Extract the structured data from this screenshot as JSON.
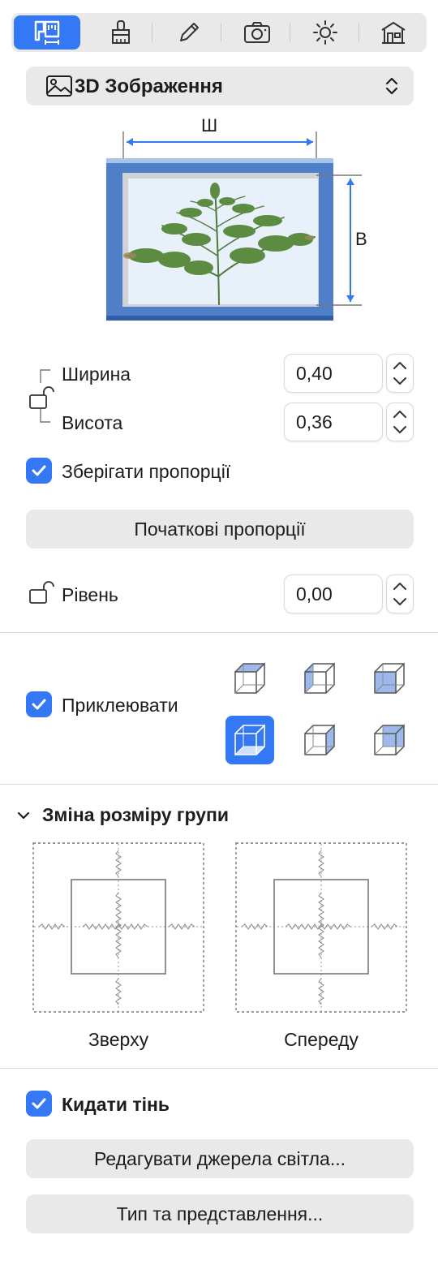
{
  "toolbar": {
    "tabs": [
      {
        "icon": "dimensions-icon",
        "active": true
      },
      {
        "icon": "brush-icon",
        "active": false
      },
      {
        "icon": "pencil-icon",
        "active": false
      },
      {
        "icon": "camera-icon",
        "active": false
      },
      {
        "icon": "sun-icon",
        "active": false
      },
      {
        "icon": "house-icon",
        "active": false
      }
    ]
  },
  "object_type": {
    "label": "3D Зображення",
    "icon": "image-icon"
  },
  "preview": {
    "width_marker": "Ш",
    "height_marker": "В"
  },
  "size": {
    "width_label": "Ширина",
    "width_value": "0,40",
    "height_label": "Висота",
    "height_value": "0,36"
  },
  "keep_proportions": {
    "label": "Зберігати пропорції",
    "checked": true
  },
  "reset_proportions_button": "Початкові пропорції",
  "level": {
    "label": "Рівень",
    "value": "0,00"
  },
  "glue": {
    "label": "Приклеювати",
    "checked": true,
    "selected_option": 4
  },
  "group_resize": {
    "title": "Зміна розміру групи",
    "top_label": "Зверху",
    "front_label": "Спереду"
  },
  "cast_shadow": {
    "label": "Кидати тінь",
    "checked": true
  },
  "edit_lights_button": "Редагувати джерела світла...",
  "type_button": "Тип та представлення...",
  "colors": {
    "accent": "#3478f6",
    "frame": "#4f7fc9"
  }
}
